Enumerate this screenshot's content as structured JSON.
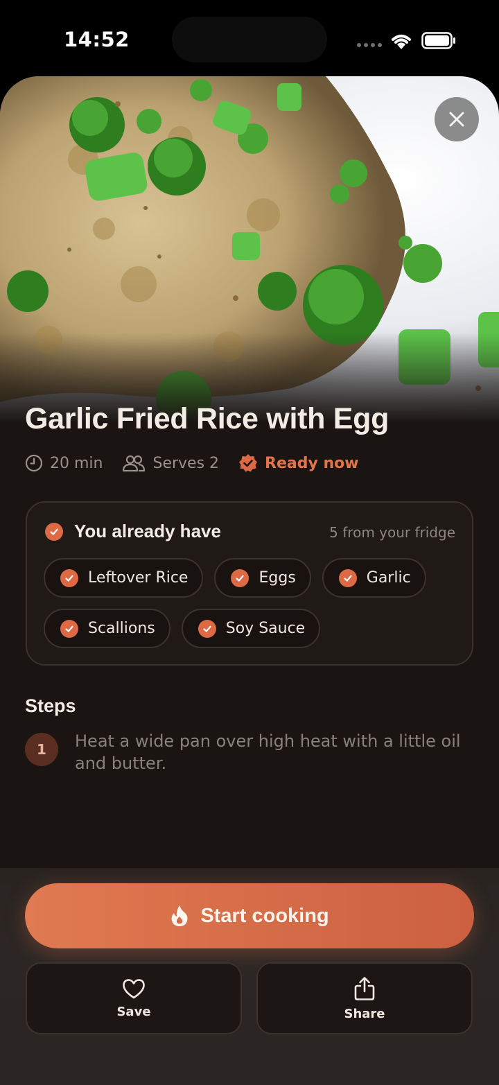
{
  "status_bar": {
    "time": "14:52"
  },
  "recipe": {
    "title": "Garlic Fried Rice with Egg",
    "meta": {
      "time": "20 min",
      "serves": "Serves 2",
      "status": "Ready now"
    }
  },
  "have_card": {
    "title": "You already have",
    "count": "5 from your fridge",
    "ingredients": [
      "Leftover Rice",
      "Eggs",
      "Garlic",
      "Scallions",
      "Soy Sauce"
    ]
  },
  "steps": {
    "title": "Steps",
    "items": [
      {
        "number": "1",
        "text": "Heat a wide pan over high heat with a little oil and butter."
      }
    ]
  },
  "actions": {
    "start_label": "Start cooking",
    "save_label": "Save",
    "share_label": "Share"
  },
  "colors": {
    "accent": "#dd6a44",
    "background": "#1a1512",
    "panel": "#2c2725"
  },
  "icons": {
    "close": "close-icon",
    "clock": "clock-icon",
    "people": "people-icon",
    "verified": "verified-badge-icon",
    "check": "check-icon",
    "flame": "flame-icon",
    "heart": "heart-icon",
    "share": "share-icon"
  }
}
